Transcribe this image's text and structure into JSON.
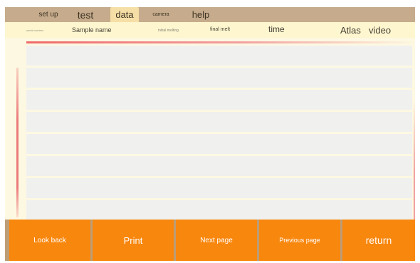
{
  "menu": {
    "setup": "set up",
    "test": "test",
    "data": "data",
    "camera": "camera",
    "help": "help",
    "active": "data"
  },
  "columns": {
    "serial": "serial number",
    "sample_name": "Sample name",
    "initial_melting": "initial melting",
    "final_melt": "final melt",
    "time": "time",
    "atlas": "Atlas",
    "video": "video"
  },
  "rows": [
    {
      "cells": []
    },
    {
      "cells": []
    },
    {
      "cells": []
    },
    {
      "cells": []
    },
    {
      "cells": []
    },
    {
      "cells": []
    },
    {
      "cells": []
    },
    {
      "cells": []
    }
  ],
  "buttons": {
    "look_back": "Look back",
    "print": "Print",
    "next_page": "Next page",
    "previous_page": "Previous page",
    "return": "return"
  },
  "colors": {
    "menu_bar": "#c6ac8c",
    "active_tab": "#f6dfa6",
    "screen_bg": "#fdf8e1",
    "row_bg": "#f0f0ef",
    "accent": "#f06a6a",
    "button": "#f8870e",
    "button_bar": "#bd9d75"
  }
}
